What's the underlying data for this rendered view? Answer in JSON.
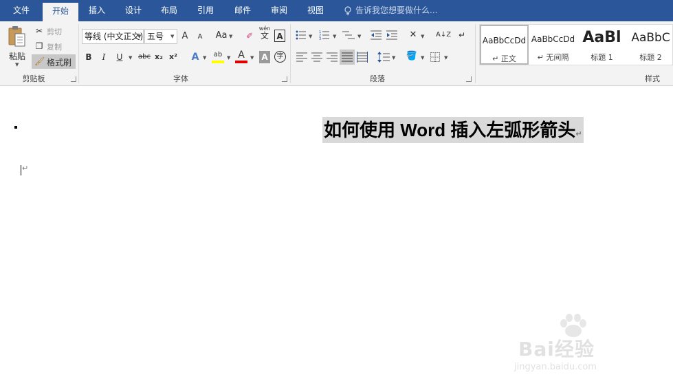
{
  "tabs": [
    "文件",
    "开始",
    "插入",
    "设计",
    "布局",
    "引用",
    "邮件",
    "审阅",
    "视图"
  ],
  "active_tab": "开始",
  "tell_me": "告诉我您想要做什么...",
  "clipboard": {
    "paste": "粘贴",
    "cut": "剪切",
    "copy": "复制",
    "format_painter": "格式刷",
    "group_label": "剪贴板"
  },
  "font": {
    "font_name": "等线 (中文正文)",
    "font_size": "五号",
    "grow": "A",
    "shrink": "A",
    "change_case": "Aa",
    "phonetic_top": "wén",
    "phonetic_bottom": "文",
    "char_border": "A",
    "bold": "B",
    "italic": "I",
    "underline": "U",
    "strike": "abc",
    "subscript": "x₂",
    "superscript": "x²",
    "text_effects": "A",
    "highlight": "ab",
    "font_color": "A",
    "char_shading": "A",
    "enclose": "字",
    "group_label": "字体"
  },
  "paragraph": {
    "sort": "A↓Z",
    "show_marks": "↵",
    "group_label": "段落"
  },
  "styles": {
    "items": [
      {
        "sample": "AaBbCcDd",
        "name": "正文",
        "mark": "↵"
      },
      {
        "sample": "AaBbCcDd",
        "name": "无间隔",
        "mark": "↵"
      },
      {
        "sample": "AaBl",
        "name": "标题 1",
        "mark": ""
      },
      {
        "sample": "AaBbC",
        "name": "标题 2",
        "mark": ""
      }
    ],
    "group_label": "样式"
  },
  "document": {
    "heading": "如何使用 Word 插入左弧形箭头",
    "paragraph_mark": "↵"
  },
  "watermark": {
    "brand": "Bai经验",
    "url": "jingyan.baidu.com"
  },
  "colors": {
    "title_bar": "#2b579a",
    "ribbon": "#f3f3f3",
    "highlight_yellow": "#ffff00",
    "font_color_red": "#e00000",
    "heading_bg": "#d9d9d9"
  }
}
